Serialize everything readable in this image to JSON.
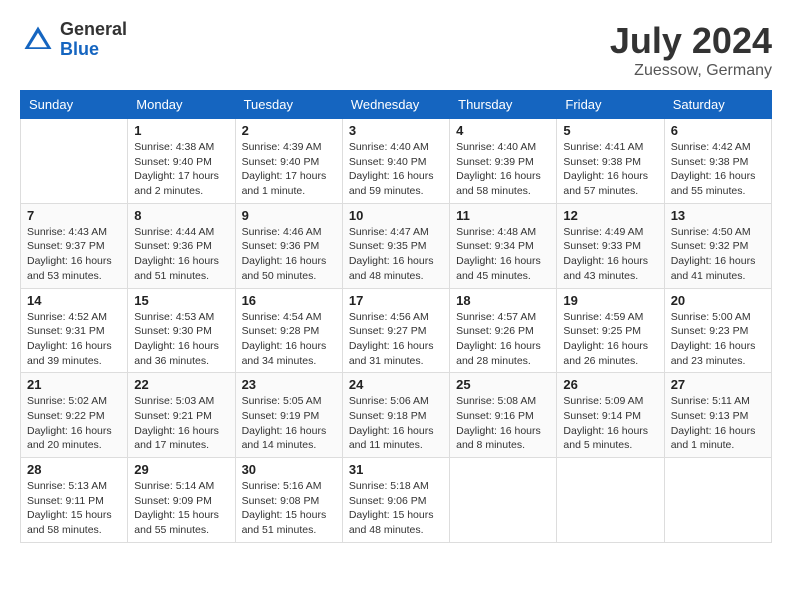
{
  "header": {
    "logo_general": "General",
    "logo_blue": "Blue",
    "month_title": "July 2024",
    "location": "Zuessow, Germany"
  },
  "weekdays": [
    "Sunday",
    "Monday",
    "Tuesday",
    "Wednesday",
    "Thursday",
    "Friday",
    "Saturday"
  ],
  "weeks": [
    [
      {
        "day": "",
        "info": ""
      },
      {
        "day": "1",
        "info": "Sunrise: 4:38 AM\nSunset: 9:40 PM\nDaylight: 17 hours\nand 2 minutes."
      },
      {
        "day": "2",
        "info": "Sunrise: 4:39 AM\nSunset: 9:40 PM\nDaylight: 17 hours\nand 1 minute."
      },
      {
        "day": "3",
        "info": "Sunrise: 4:40 AM\nSunset: 9:40 PM\nDaylight: 16 hours\nand 59 minutes."
      },
      {
        "day": "4",
        "info": "Sunrise: 4:40 AM\nSunset: 9:39 PM\nDaylight: 16 hours\nand 58 minutes."
      },
      {
        "day": "5",
        "info": "Sunrise: 4:41 AM\nSunset: 9:38 PM\nDaylight: 16 hours\nand 57 minutes."
      },
      {
        "day": "6",
        "info": "Sunrise: 4:42 AM\nSunset: 9:38 PM\nDaylight: 16 hours\nand 55 minutes."
      }
    ],
    [
      {
        "day": "7",
        "info": "Sunrise: 4:43 AM\nSunset: 9:37 PM\nDaylight: 16 hours\nand 53 minutes."
      },
      {
        "day": "8",
        "info": "Sunrise: 4:44 AM\nSunset: 9:36 PM\nDaylight: 16 hours\nand 51 minutes."
      },
      {
        "day": "9",
        "info": "Sunrise: 4:46 AM\nSunset: 9:36 PM\nDaylight: 16 hours\nand 50 minutes."
      },
      {
        "day": "10",
        "info": "Sunrise: 4:47 AM\nSunset: 9:35 PM\nDaylight: 16 hours\nand 48 minutes."
      },
      {
        "day": "11",
        "info": "Sunrise: 4:48 AM\nSunset: 9:34 PM\nDaylight: 16 hours\nand 45 minutes."
      },
      {
        "day": "12",
        "info": "Sunrise: 4:49 AM\nSunset: 9:33 PM\nDaylight: 16 hours\nand 43 minutes."
      },
      {
        "day": "13",
        "info": "Sunrise: 4:50 AM\nSunset: 9:32 PM\nDaylight: 16 hours\nand 41 minutes."
      }
    ],
    [
      {
        "day": "14",
        "info": "Sunrise: 4:52 AM\nSunset: 9:31 PM\nDaylight: 16 hours\nand 39 minutes."
      },
      {
        "day": "15",
        "info": "Sunrise: 4:53 AM\nSunset: 9:30 PM\nDaylight: 16 hours\nand 36 minutes."
      },
      {
        "day": "16",
        "info": "Sunrise: 4:54 AM\nSunset: 9:28 PM\nDaylight: 16 hours\nand 34 minutes."
      },
      {
        "day": "17",
        "info": "Sunrise: 4:56 AM\nSunset: 9:27 PM\nDaylight: 16 hours\nand 31 minutes."
      },
      {
        "day": "18",
        "info": "Sunrise: 4:57 AM\nSunset: 9:26 PM\nDaylight: 16 hours\nand 28 minutes."
      },
      {
        "day": "19",
        "info": "Sunrise: 4:59 AM\nSunset: 9:25 PM\nDaylight: 16 hours\nand 26 minutes."
      },
      {
        "day": "20",
        "info": "Sunrise: 5:00 AM\nSunset: 9:23 PM\nDaylight: 16 hours\nand 23 minutes."
      }
    ],
    [
      {
        "day": "21",
        "info": "Sunrise: 5:02 AM\nSunset: 9:22 PM\nDaylight: 16 hours\nand 20 minutes."
      },
      {
        "day": "22",
        "info": "Sunrise: 5:03 AM\nSunset: 9:21 PM\nDaylight: 16 hours\nand 17 minutes."
      },
      {
        "day": "23",
        "info": "Sunrise: 5:05 AM\nSunset: 9:19 PM\nDaylight: 16 hours\nand 14 minutes."
      },
      {
        "day": "24",
        "info": "Sunrise: 5:06 AM\nSunset: 9:18 PM\nDaylight: 16 hours\nand 11 minutes."
      },
      {
        "day": "25",
        "info": "Sunrise: 5:08 AM\nSunset: 9:16 PM\nDaylight: 16 hours\nand 8 minutes."
      },
      {
        "day": "26",
        "info": "Sunrise: 5:09 AM\nSunset: 9:14 PM\nDaylight: 16 hours\nand 5 minutes."
      },
      {
        "day": "27",
        "info": "Sunrise: 5:11 AM\nSunset: 9:13 PM\nDaylight: 16 hours\nand 1 minute."
      }
    ],
    [
      {
        "day": "28",
        "info": "Sunrise: 5:13 AM\nSunset: 9:11 PM\nDaylight: 15 hours\nand 58 minutes."
      },
      {
        "day": "29",
        "info": "Sunrise: 5:14 AM\nSunset: 9:09 PM\nDaylight: 15 hours\nand 55 minutes."
      },
      {
        "day": "30",
        "info": "Sunrise: 5:16 AM\nSunset: 9:08 PM\nDaylight: 15 hours\nand 51 minutes."
      },
      {
        "day": "31",
        "info": "Sunrise: 5:18 AM\nSunset: 9:06 PM\nDaylight: 15 hours\nand 48 minutes."
      },
      {
        "day": "",
        "info": ""
      },
      {
        "day": "",
        "info": ""
      },
      {
        "day": "",
        "info": ""
      }
    ]
  ]
}
